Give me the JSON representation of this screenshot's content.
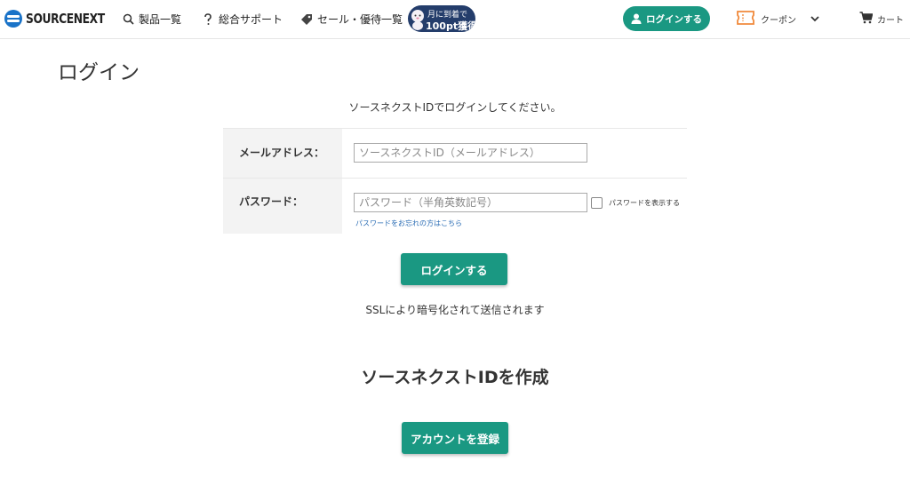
{
  "header": {
    "logo_text": "SOURCENEXT",
    "nav": {
      "products": "製品一覧",
      "support": "総合サポート",
      "sale": "セール・優待一覧"
    },
    "promo": {
      "line1": "月に到着で",
      "line2": "100pt獲得"
    },
    "login_button": "ログインする",
    "coupon": "クーポン",
    "cart": "カート",
    "icons": [
      "search-icon",
      "question-icon",
      "tag-icon",
      "user-icon",
      "ticket-icon",
      "chevron-down-icon",
      "cart-icon"
    ]
  },
  "page": {
    "title": "ログイン",
    "intro": "ソースネクストIDでログインしてください。"
  },
  "form": {
    "email_label": "メールアドレス：",
    "email_placeholder": "ソースネクストID（メールアドレス）",
    "password_label": "パスワード：",
    "password_placeholder": "パスワード（半角英数記号）",
    "show_password_label": "パスワードを表示する",
    "forgot_link": "パスワードをお忘れの方はこちら"
  },
  "actions": {
    "login_button": "ログインする",
    "ssl_note": "SSLにより暗号化されて送信されます"
  },
  "create_account": {
    "title": "ソースネクストIDを作成",
    "register_button": "アカウントを登録"
  },
  "colors": {
    "accent": "#1a9882",
    "link": "#2a6cb4",
    "promo_bg": "#243d6b",
    "coupon_icon": "#f08a3c"
  }
}
